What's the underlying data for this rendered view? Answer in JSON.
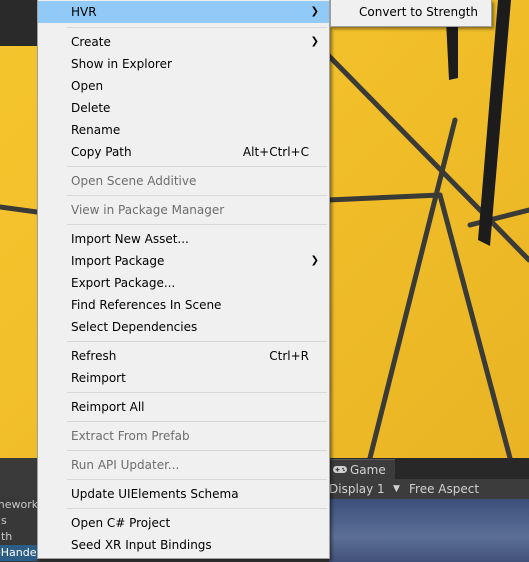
{
  "context_menu": {
    "items": [
      {
        "label": "HVR",
        "has_submenu": true,
        "highlighted": true
      },
      {
        "label": "Create",
        "has_submenu": true
      },
      {
        "label": "Show in Explorer"
      },
      {
        "label": "Open"
      },
      {
        "label": "Delete"
      },
      {
        "label": "Rename"
      },
      {
        "label": "Copy Path",
        "shortcut": "Alt+Ctrl+C"
      },
      {
        "label": "Open Scene Additive",
        "disabled": true
      },
      {
        "label": "View in Package Manager",
        "disabled": true
      },
      {
        "label": "Import New Asset..."
      },
      {
        "label": "Import Package",
        "has_submenu": true
      },
      {
        "label": "Export Package..."
      },
      {
        "label": "Find References In Scene"
      },
      {
        "label": "Select Dependencies"
      },
      {
        "label": "Refresh",
        "shortcut": "Ctrl+R"
      },
      {
        "label": "Reimport"
      },
      {
        "label": "Reimport All"
      },
      {
        "label": "Extract From Prefab",
        "disabled": true
      },
      {
        "label": "Run API Updater...",
        "disabled": true
      },
      {
        "label": "Update UIElements Schema"
      },
      {
        "label": "Open C# Project"
      },
      {
        "label": "Seed XR Input Bindings"
      }
    ]
  },
  "submenu": {
    "items": [
      {
        "label": "Convert to Strength"
      }
    ]
  },
  "game_panel": {
    "tab_label": "Game",
    "display_label": "Display 1",
    "aspect_label": "Free Aspect"
  },
  "hierarchy_fragment": {
    "rows": [
      "mework",
      "gs",
      "gth",
      "oHandes"
    ]
  },
  "colors": {
    "menu_bg": "#f0f0f0",
    "highlight": "#91c9f7",
    "disabled_text": "#6d6d6d",
    "scene_yellow": "#f2c02a"
  }
}
